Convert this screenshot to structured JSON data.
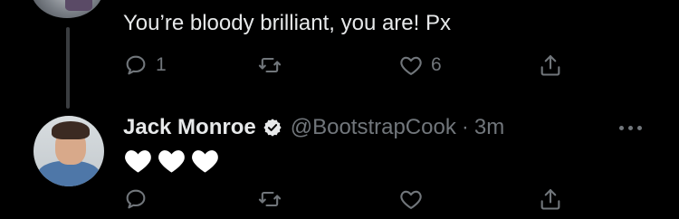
{
  "thread": {
    "previous_tweet": {
      "text": "You’re bloody brilliant, you are! Px",
      "actions": {
        "reply_count": "1",
        "retweet_count": "",
        "like_count": "6"
      }
    },
    "tweet": {
      "display_name": "Jack Monroe",
      "handle": "@BootstrapCook",
      "separator": "·",
      "time": "3m",
      "content_emoji": [
        "white-heart",
        "white-heart",
        "white-heart"
      ],
      "actions": {
        "reply_count": "",
        "retweet_count": "",
        "like_count": ""
      }
    }
  },
  "icons": {
    "reply": "reply-icon",
    "retweet": "retweet-icon",
    "like": "heart-icon",
    "share": "share-icon",
    "verified": "verified-badge-icon",
    "more": "more-icon"
  },
  "colors": {
    "background": "#000000",
    "primary_text": "#e7e9ea",
    "secondary_text": "#71767b",
    "thread_line": "#3a3d40"
  }
}
